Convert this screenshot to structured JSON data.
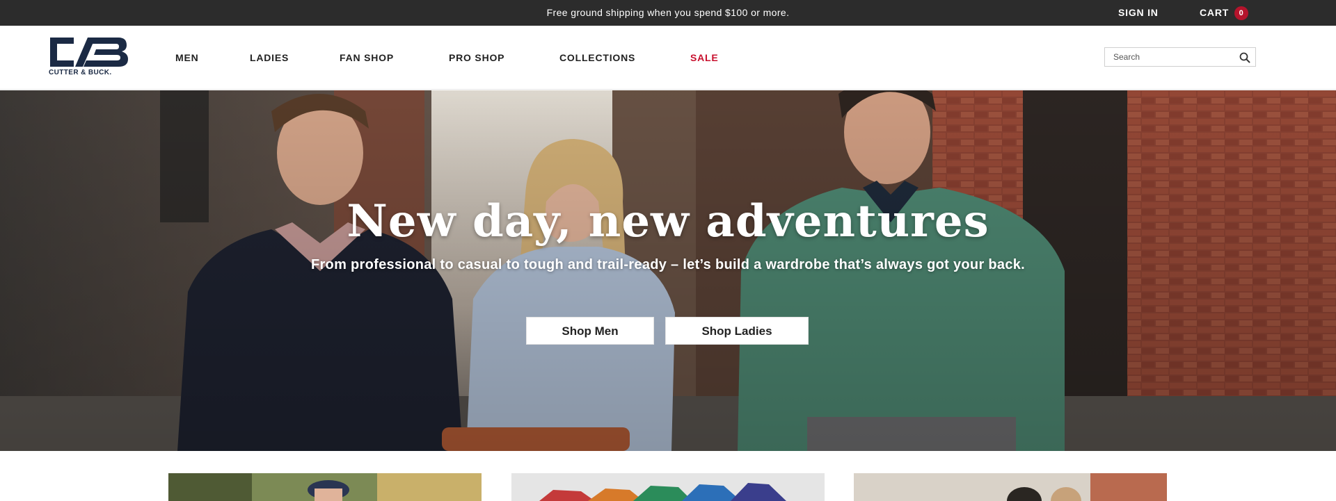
{
  "topbar": {
    "promo": "Free ground shipping when you spend $100 or more.",
    "sign_in": "SIGN IN",
    "cart_label": "CART",
    "cart_count": "0"
  },
  "brand": {
    "name": "CUTTER & BUCK.",
    "logo_color": "#1b2a44"
  },
  "nav": {
    "items": [
      {
        "label": "MEN"
      },
      {
        "label": "LADIES"
      },
      {
        "label": "FAN SHOP"
      },
      {
        "label": "PRO SHOP"
      },
      {
        "label": "COLLECTIONS"
      },
      {
        "label": "SALE"
      }
    ]
  },
  "search": {
    "placeholder": "Search",
    "icon": "search-icon"
  },
  "hero": {
    "title": "New day, new adventures",
    "subtitle": "From professional to casual to tough and trail-ready – let’s build a wardrobe that’s always got your back.",
    "buttons": {
      "shop_men": "Shop Men",
      "shop_ladies": "Shop Ladies"
    }
  },
  "colors": {
    "topbar_bg": "#2c2c2c",
    "sale": "#c8102e",
    "cart_badge": "#b4142c"
  }
}
